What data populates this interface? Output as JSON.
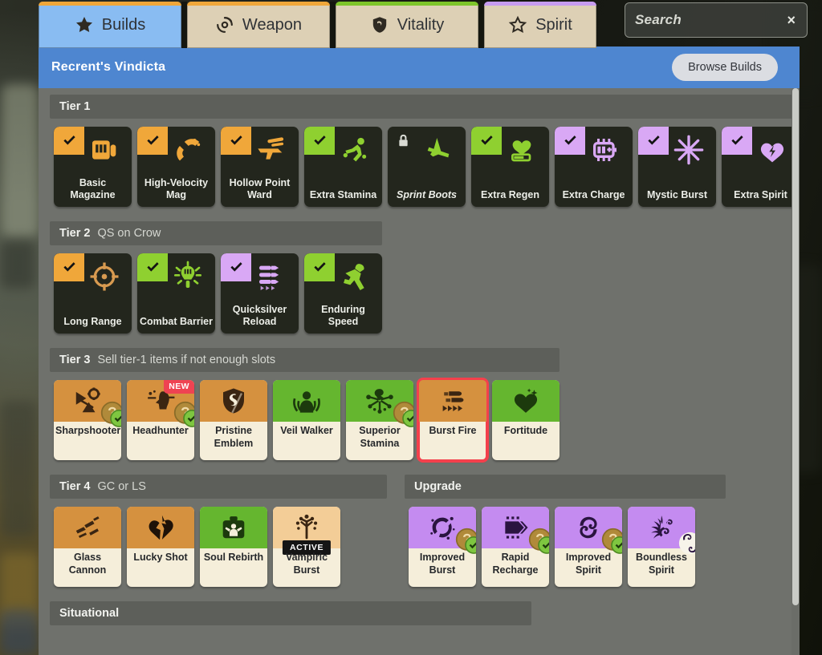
{
  "tabs": [
    {
      "label": "Builds",
      "icon": "star-icon",
      "accent": "#f0a73a",
      "active": true
    },
    {
      "label": "Weapon",
      "icon": "target-icon",
      "accent": "#f0a73a",
      "active": false
    },
    {
      "label": "Vitality",
      "icon": "shield-icon",
      "accent": "#7ec52a",
      "active": false
    },
    {
      "label": "Spirit",
      "icon": "star-outline-icon",
      "accent": "#c79cf0",
      "active": false
    }
  ],
  "search": {
    "value": "Search",
    "placeholder": "Search",
    "clear_label": "×"
  },
  "build": {
    "title": "Recrent's Vindicta",
    "browse_label": "Browse Builds"
  },
  "sections": [
    {
      "title": "Tier 1",
      "note": "",
      "style": "dark",
      "items": [
        {
          "name": "Basic Magazine",
          "corner": "check",
          "corner_color": "#f0a73a",
          "icon_color": "#f0a73a",
          "glyph": "magazine-icon",
          "locked": false
        },
        {
          "name": "High-Velocity Mag",
          "corner": "check",
          "corner_color": "#f0a73a",
          "icon_color": "#f0a73a",
          "glyph": "magnet-icon",
          "locked": false
        },
        {
          "name": "Hollow Point Ward",
          "corner": "check",
          "corner_color": "#f0a73a",
          "icon_color": "#f0a73a",
          "glyph": "pistol-icon",
          "locked": false
        },
        {
          "name": "Extra Stamina",
          "corner": "check",
          "corner_color": "#8fd030",
          "icon_color": "#8fd030",
          "glyph": "legs-run-icon",
          "locked": false
        },
        {
          "name": "Sprint Boots",
          "corner": "lock",
          "corner_color": "#23261d",
          "icon_color": "#8fd030",
          "glyph": "boot-icon",
          "locked": true
        },
        {
          "name": "Extra Regen",
          "corner": "check",
          "corner_color": "#8fd030",
          "icon_color": "#8fd030",
          "glyph": "heart-bar-icon",
          "locked": false
        },
        {
          "name": "Extra Charge",
          "corner": "check",
          "corner_color": "#d9a8f5",
          "icon_color": "#d9a8f5",
          "glyph": "battery-icon",
          "locked": false
        },
        {
          "name": "Mystic Burst",
          "corner": "check",
          "corner_color": "#d9a8f5",
          "icon_color": "#d9a8f5",
          "glyph": "sparkle-icon",
          "locked": false
        },
        {
          "name": "Extra Spirit",
          "corner": "check",
          "corner_color": "#d9a8f5",
          "icon_color": "#d9a8f5",
          "glyph": "heart-bolt-icon",
          "locked": false
        }
      ]
    },
    {
      "title": "Tier 2",
      "note": "QS on Crow",
      "style": "dark",
      "items": [
        {
          "name": "Long Range",
          "corner": "check",
          "corner_color": "#f0a73a",
          "icon_color": "#d89a50",
          "glyph": "crosshair-icon",
          "locked": false
        },
        {
          "name": "Combat Barrier",
          "corner": "check",
          "corner_color": "#8fd030",
          "icon_color": "#8fd030",
          "glyph": "barrier-icon",
          "locked": false
        },
        {
          "name": "Quicksilver Reload",
          "corner": "check",
          "corner_color": "#d9a8f5",
          "icon_color": "#d9a8f5",
          "glyph": "bullets-icon",
          "locked": false
        },
        {
          "name": "Enduring Speed",
          "corner": "check",
          "corner_color": "#8fd030",
          "icon_color": "#8fd030",
          "glyph": "sprinter-icon",
          "locked": false
        }
      ]
    },
    {
      "title": "Tier 3",
      "note": "Sell tier-1 items if not enough slots",
      "style": "light",
      "items": [
        {
          "name": "Sharpshooter",
          "top_color": "#d5913f",
          "icon_color": "#3a2512",
          "glyph": "sniper-icon",
          "owned": true,
          "badge": ""
        },
        {
          "name": "Headhunter",
          "top_color": "#d5913f",
          "icon_color": "#3a2512",
          "glyph": "head-icon",
          "owned": true,
          "badge": "NEW"
        },
        {
          "name": "Pristine Emblem",
          "top_color": "#d5913f",
          "icon_color": "#3a2512",
          "glyph": "emblem-icon",
          "owned": false,
          "badge": ""
        },
        {
          "name": "Veil Walker",
          "top_color": "#65b62f",
          "icon_color": "#1c3a0d",
          "glyph": "veil-icon",
          "owned": false,
          "badge": ""
        },
        {
          "name": "Superior Stamina",
          "top_color": "#65b62f",
          "icon_color": "#1c3a0d",
          "glyph": "burst-leap-icon",
          "owned": true,
          "badge": ""
        },
        {
          "name": "Burst Fire",
          "top_color": "#d5913f",
          "icon_color": "#3a2512",
          "glyph": "burst-fire-icon",
          "owned": false,
          "badge": "",
          "selected": true
        },
        {
          "name": "Fortitude",
          "top_color": "#65b62f",
          "icon_color": "#1c3a0d",
          "glyph": "heart-icon",
          "owned": false,
          "badge": ""
        }
      ]
    },
    {
      "title": "Tier 4",
      "note": "GC or LS",
      "style": "light",
      "items": [
        {
          "name": "Glass Cannon",
          "top_color": "#d5913f",
          "icon_color": "#3a2512",
          "glyph": "shards-icon",
          "owned": false,
          "badge": ""
        },
        {
          "name": "Lucky Shot",
          "top_color": "#d5913f",
          "icon_color": "#1e1208",
          "glyph": "broken-heart-icon",
          "owned": false,
          "badge": ""
        },
        {
          "name": "Soul Rebirth",
          "top_color": "#65b62f",
          "icon_color": "#1c3a0d",
          "glyph": "rebirth-icon",
          "owned": false,
          "badge": ""
        },
        {
          "name": "Vampiric Burst",
          "top_color": "#f3cd97",
          "icon_color": "#3a2512",
          "glyph": "vampiric-icon",
          "owned": false,
          "badge": "ACTIVE"
        }
      ]
    },
    {
      "title": "Upgrade",
      "note": "",
      "style": "light",
      "items": [
        {
          "name": "Improved Burst",
          "top_color": "#c48bf0",
          "icon_color": "#2a1440",
          "glyph": "burst-ring-icon",
          "owned": true,
          "badge": ""
        },
        {
          "name": "Rapid Recharge",
          "top_color": "#c48bf0",
          "icon_color": "#2a1440",
          "glyph": "recharge-icon",
          "owned": true,
          "badge": ""
        },
        {
          "name": "Improved Spirit",
          "top_color": "#c48bf0",
          "icon_color": "#2a1440",
          "glyph": "spiral-icon",
          "owned": true,
          "badge": ""
        },
        {
          "name": "Boundless Spirit",
          "top_color": "#c48bf0",
          "icon_color": "#2a1440",
          "glyph": "boundless-icon",
          "owned": false,
          "badge": ""
        }
      ]
    },
    {
      "title": "Situational",
      "note": "",
      "style": "light",
      "items": []
    }
  ],
  "colors": {
    "accent_blue": "#4e86d0",
    "panel_gray": "#6f716c",
    "header_gray": "#5d5f5a",
    "selected_red": "#f4404c",
    "new_badge_red": "#ef4352",
    "weapon_orange": "#f0a73a",
    "vitality_green": "#8fd030",
    "spirit_purple": "#d9a8f5"
  },
  "scrollbar": {
    "present": true
  }
}
